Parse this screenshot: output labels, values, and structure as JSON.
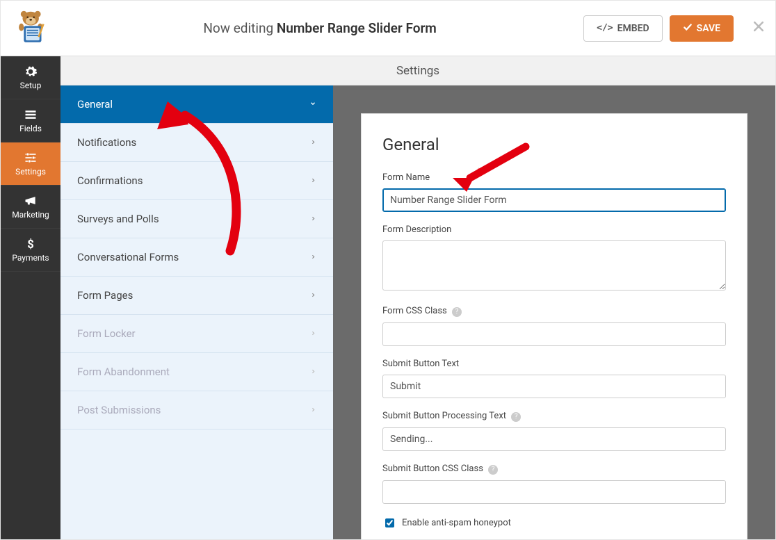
{
  "header": {
    "now_editing_prefix": "Now editing",
    "form_title": "Number Range Slider Form",
    "embed_label": "EMBED",
    "save_label": "SAVE"
  },
  "vnav": {
    "items": [
      {
        "icon": "gear",
        "label": "Setup"
      },
      {
        "icon": "list",
        "label": "Fields"
      },
      {
        "icon": "sliders",
        "label": "Settings",
        "active": true
      },
      {
        "icon": "bullhorn",
        "label": "Marketing"
      },
      {
        "icon": "dollar",
        "label": "Payments"
      }
    ]
  },
  "settings_header": "Settings",
  "settings_list": {
    "items": [
      {
        "label": "General",
        "active": true,
        "expand": true
      },
      {
        "label": "Notifications"
      },
      {
        "label": "Confirmations"
      },
      {
        "label": "Surveys and Polls"
      },
      {
        "label": "Conversational Forms"
      },
      {
        "label": "Form Pages"
      },
      {
        "label": "Form Locker",
        "disabled": true
      },
      {
        "label": "Form Abandonment",
        "disabled": true
      },
      {
        "label": "Post Submissions",
        "disabled": true
      }
    ]
  },
  "panel": {
    "heading": "General",
    "form_name_label": "Form Name",
    "form_name_value": "Number Range Slider Form",
    "form_desc_label": "Form Description",
    "form_desc_value": "",
    "css_class_label": "Form CSS Class",
    "css_class_value": "",
    "submit_text_label": "Submit Button Text",
    "submit_text_value": "Submit",
    "submit_processing_label": "Submit Button Processing Text",
    "submit_processing_value": "Sending...",
    "submit_css_label": "Submit Button CSS Class",
    "submit_css_value": "",
    "antispam_label": "Enable anti-spam honeypot"
  }
}
